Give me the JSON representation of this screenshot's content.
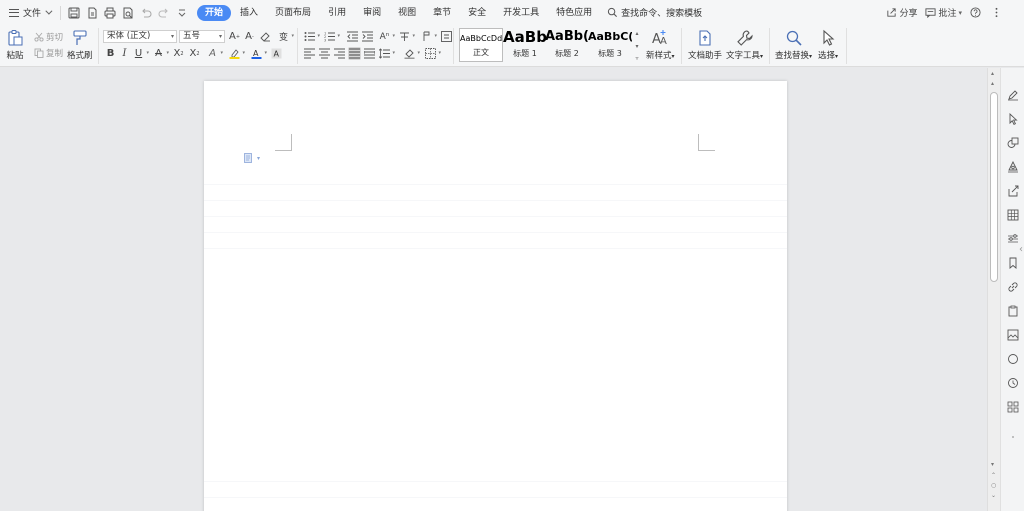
{
  "menubar": {
    "file_label": "文件",
    "tabs": [
      {
        "label": "开始",
        "active": true
      },
      {
        "label": "插入",
        "active": false
      },
      {
        "label": "页面布局",
        "active": false
      },
      {
        "label": "引用",
        "active": false
      },
      {
        "label": "审阅",
        "active": false
      },
      {
        "label": "视图",
        "active": false
      },
      {
        "label": "章节",
        "active": false
      },
      {
        "label": "安全",
        "active": false
      },
      {
        "label": "开发工具",
        "active": false
      },
      {
        "label": "特色应用",
        "active": false
      }
    ],
    "search_label": "查找命令、搜索模板",
    "share_label": "分享",
    "comment_label": "批注"
  },
  "ribbon": {
    "paste_label": "粘贴",
    "cut_label": "剪切",
    "copy_label": "复制",
    "format_painter_label": "格式刷",
    "font_name": "宋体 (正文)",
    "font_size": "五号",
    "styles": [
      {
        "preview": "AaBbCcDd",
        "label": "正文"
      },
      {
        "preview": "AaBb",
        "label": "标题 1"
      },
      {
        "preview": "AaBb(",
        "label": "标题 2"
      },
      {
        "preview": "AaBbC(",
        "label": "标题 3"
      }
    ],
    "new_style_label": "新样式",
    "doc_helper_label": "文档助手",
    "text_tools_label": "文字工具",
    "find_replace_label": "查找替换",
    "select_label": "选择"
  },
  "colors": {
    "accent": "#4a8af4",
    "highlight": "#f5d90a",
    "font_color": "#1a5fe6"
  }
}
